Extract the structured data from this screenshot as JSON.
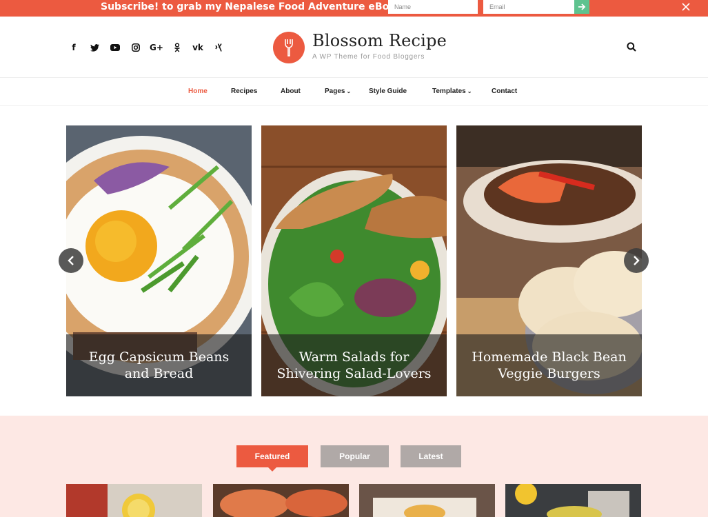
{
  "topbar": {
    "message": "Subscribe! to grab my Nepalese Food Adventure eBook!",
    "name_placeholder": "Name",
    "email_placeholder": "Email",
    "colors": {
      "bar": "#ec5a40",
      "submit": "#5ec38f"
    }
  },
  "header": {
    "social_icons": [
      "facebook-icon",
      "twitter-icon",
      "youtube-icon",
      "instagram-icon",
      "google-plus-icon",
      "odnoklassniki-icon",
      "vk-icon",
      "xing-icon"
    ],
    "site_title": "Blossom Recipe",
    "tagline": "A WP Theme for Food Bloggers",
    "logo_icon": "fork-icon",
    "search_icon": "search-icon"
  },
  "nav": {
    "items": [
      {
        "label": "Home",
        "active": true
      },
      {
        "label": "Recipes"
      },
      {
        "label": "About"
      },
      {
        "label": "Pages",
        "has_dropdown": true
      },
      {
        "label": "Style Guide"
      },
      {
        "label": "Templates",
        "has_dropdown": true
      },
      {
        "label": "Contact"
      }
    ]
  },
  "slider": {
    "slides": [
      {
        "title": "Egg Capsicum Beans and Bread"
      },
      {
        "title": "Warm Salads for Shivering Salad-Lovers"
      },
      {
        "title": "Homemade Black Bean Veggie Burgers"
      }
    ],
    "prev_icon": "chevron-left-icon",
    "next_icon": "chevron-right-icon"
  },
  "featured": {
    "tabs": [
      {
        "label": "Featured",
        "active": true
      },
      {
        "label": "Popular"
      },
      {
        "label": "Latest"
      }
    ],
    "accent": "#ec5a40",
    "background": "#fde8e4"
  }
}
